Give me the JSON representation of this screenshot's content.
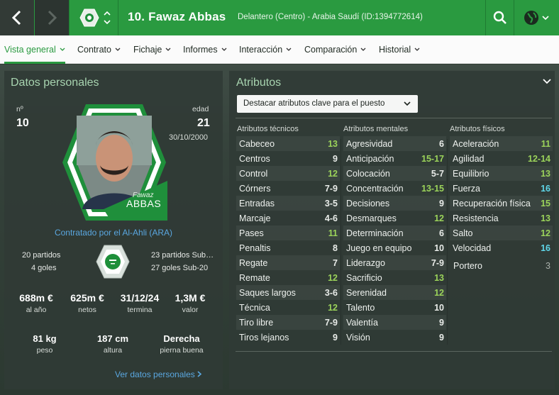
{
  "header": {
    "title": "10. Fawaz Abbas",
    "subtitle": "Delantero (Centro) - Arabia Saudí (ID:1394772614)"
  },
  "tabs": [
    {
      "label": "Vista general"
    },
    {
      "label": "Contrato"
    },
    {
      "label": "Fichaje"
    },
    {
      "label": "Informes"
    },
    {
      "label": "Interacción"
    },
    {
      "label": "Comparación"
    },
    {
      "label": "Historial"
    }
  ],
  "personal": {
    "title": "Datos personales",
    "number_label": "nº",
    "number": "10",
    "age_label": "edad",
    "age": "21",
    "dob": "30/10/2000",
    "card_first": "Fawaz",
    "card_last": "ABBAS",
    "contract": "Contratado por el Al-Ahli (ARA)",
    "apps_senior": "20 partidos",
    "goals_senior": "4 goles",
    "apps_u20": "23 partidos Sub-20",
    "goals_u20": "27 goles Sub-20",
    "money": [
      {
        "value": "688m €",
        "label": "al año"
      },
      {
        "value": "625m €",
        "label": "netos"
      },
      {
        "value": "31/12/24",
        "label": "termina"
      },
      {
        "value": "1,3M €",
        "label": "valor"
      }
    ],
    "body": [
      {
        "value": "81 kg",
        "label": "peso"
      },
      {
        "value": "187 cm",
        "label": "altura"
      },
      {
        "value": "Derecha",
        "label": "pierna buena"
      }
    ],
    "more_link": "Ver datos personales"
  },
  "attributes": {
    "title": "Atributos",
    "highlight_select": "Destacar atributos clave para el puesto",
    "technical_header": "Atributos técnicos",
    "mental_header": "Atributos mentales",
    "physical_header": "Atributos físicos",
    "technical": [
      {
        "name": "Cabeceo",
        "value": "13",
        "tone": "mid"
      },
      {
        "name": "Centros",
        "value": "9",
        "tone": "low"
      },
      {
        "name": "Control",
        "value": "12",
        "tone": "mid"
      },
      {
        "name": "Córners",
        "value": "7-9",
        "tone": "low"
      },
      {
        "name": "Entradas",
        "value": "3-5",
        "tone": "low"
      },
      {
        "name": "Marcaje",
        "value": "4-6",
        "tone": "low"
      },
      {
        "name": "Pases",
        "value": "11",
        "tone": "mid"
      },
      {
        "name": "Penaltis",
        "value": "8",
        "tone": "low"
      },
      {
        "name": "Regate",
        "value": "7",
        "tone": "low"
      },
      {
        "name": "Remate",
        "value": "12",
        "tone": "mid"
      },
      {
        "name": "Saques largos",
        "value": "3-6",
        "tone": "low"
      },
      {
        "name": "Técnica",
        "value": "12",
        "tone": "mid"
      },
      {
        "name": "Tiro libre",
        "value": "7-9",
        "tone": "low"
      },
      {
        "name": "Tiros lejanos",
        "value": "9",
        "tone": "low"
      }
    ],
    "mental": [
      {
        "name": "Agresividad",
        "value": "6",
        "tone": "low"
      },
      {
        "name": "Anticipación",
        "value": "15-17",
        "tone": "mid"
      },
      {
        "name": "Colocación",
        "value": "5-7",
        "tone": "low"
      },
      {
        "name": "Concentración",
        "value": "13-15",
        "tone": "mid"
      },
      {
        "name": "Decisiones",
        "value": "9",
        "tone": "low"
      },
      {
        "name": "Desmarques",
        "value": "12",
        "tone": "mid"
      },
      {
        "name": "Determinación",
        "value": "6",
        "tone": "low"
      },
      {
        "name": "Juego en equipo",
        "value": "10",
        "tone": "low"
      },
      {
        "name": "Liderazgo",
        "value": "7-9",
        "tone": "low"
      },
      {
        "name": "Sacrificio",
        "value": "13",
        "tone": "mid"
      },
      {
        "name": "Serenidad",
        "value": "12",
        "tone": "mid"
      },
      {
        "name": "Talento",
        "value": "10",
        "tone": "low"
      },
      {
        "name": "Valentía",
        "value": "9",
        "tone": "low"
      },
      {
        "name": "Visión",
        "value": "9",
        "tone": "low"
      }
    ],
    "physical": [
      {
        "name": "Aceleración",
        "value": "11",
        "tone": "mid"
      },
      {
        "name": "Agilidad",
        "value": "12-14",
        "tone": "mid"
      },
      {
        "name": "Equilibrio",
        "value": "13",
        "tone": "mid"
      },
      {
        "name": "Fuerza",
        "value": "16",
        "tone": "high"
      },
      {
        "name": "Recuperación física",
        "value": "15",
        "tone": "mid"
      },
      {
        "name": "Resistencia",
        "value": "13",
        "tone": "mid"
      },
      {
        "name": "Salto",
        "value": "12",
        "tone": "mid"
      },
      {
        "name": "Velocidad",
        "value": "16",
        "tone": "high"
      }
    ],
    "goalkeeper": {
      "name": "Portero",
      "value": "3",
      "tone": "grey"
    }
  }
}
